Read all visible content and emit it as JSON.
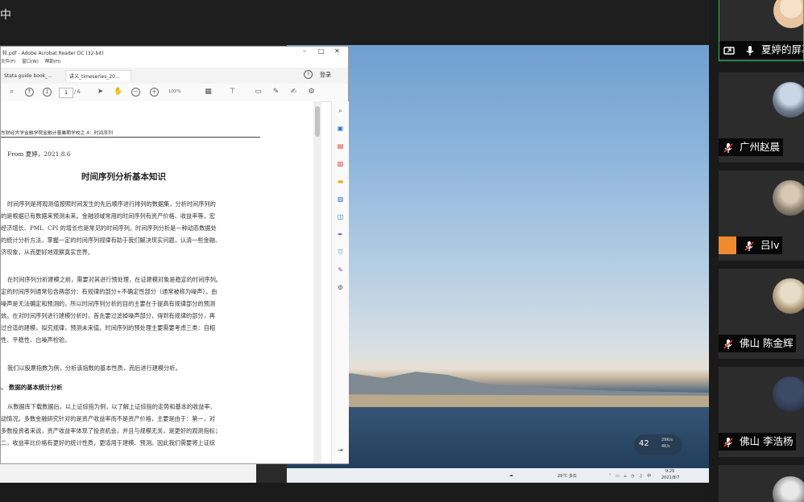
{
  "screen": {
    "top_left_label": "中"
  },
  "acrobat": {
    "title": "较.pdf - Adobe Acrobat Reader DC (32-bit)",
    "menu": [
      "文件(F)",
      "窗口(W)",
      "帮助(H)"
    ],
    "tabs": [
      "Stata guide book_...",
      "讲义_timeseries_20..."
    ],
    "signin_label": "登录",
    "help_icon": "help-icon",
    "toolbar": {
      "page_current": "1",
      "page_total": "/ 6",
      "zoom": "102%"
    }
  },
  "document": {
    "header": "东财经大学金融学院金融计量暑期学校之 4：时间序列",
    "from": "From  夏婷，2021.8.6",
    "title": "时间序列分析基本知识",
    "paragraphs": [
      "时间序列是将观测值按照时间发生的先后顺序进行排列的数据集，分析时间序列的\n的是根据已有数据来预测未来。金融领域常用的时间序列有资产价格、收益率等，宏\n经济增长、PMI、CPI 的增长也是常见的时间序列。时间序列分析是一种动态数据处\n的统计分析方法，掌握一定的时间序列规律有助于我们解决现实问题，认清一些金融、\n济现象，从而更好地观察真实世界。",
      "在时间序列分析建模之前，需要对其进行预处理，在证建模对象是稳定的时间序列。\n定的时间序列通常包含两部分：有规律的部分+不确定性部分（通常被称为噪声）。由\n噪声是无法确定和预测的，所以时间序列分析的目的主要在于提高有规律部分的预测\n效。在对时间序列进行建模分析时，首先要过滤掉噪声部分，得到有规律的部分，再\n过合适的建模，拟究规律，预测未来值。时间序列的预处理主要需要考虑三类：自相\n性、平稳性、白噪声检验。",
      "我们以股票指数为例，分析该指数的基本性质，而后进行建模分析。"
    ],
    "section_heading": "、  数据的基本统计分析",
    "paragraph_last": "从数据库下载数据后，以上证综指为例，以了解上证综指的走势和基本的收益率、\n动情况。多数金融研究针对的是资产收益率而不是资产价格，主要是由于：第一，对\n多数投资者来说，资产收益率体现了投资机会，并且与规模无关，是更好的观测指标；\n二，收益率比价格有更好的统计性质，更适用于建模、预测。因此我们需要将上证综"
  },
  "taskbar": {
    "weather": "29°C 多云",
    "time": "9:29",
    "date": "2021/8/7"
  },
  "speed_overlay": {
    "percent": "42",
    "up": "29K/s",
    "down": "4K/s"
  },
  "participants": [
    {
      "name": "夏婷的屏幕",
      "mic": "mic-icon",
      "share": "share-screen-icon"
    },
    {
      "name": "广州赵晨",
      "mic": "mic-muted-icon"
    },
    {
      "name": "吕lv",
      "mic": "mic-muted-icon"
    },
    {
      "name": "佛山 陈金辉",
      "mic": "mic-muted-icon"
    },
    {
      "name": "佛山 李浩杨",
      "mic": "mic-muted-icon"
    }
  ],
  "colors": {
    "active_speaker_border": "#2fbf5d",
    "acrobat_red_icon": "#d93a2b",
    "acrobat_blue_icon": "#2f6fd0"
  }
}
